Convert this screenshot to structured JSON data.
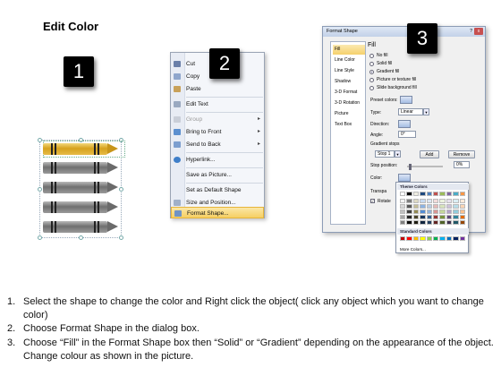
{
  "title": "Edit Color",
  "steps": {
    "one": "1",
    "two": "2",
    "three": "3"
  },
  "context_menu": {
    "items": [
      {
        "label": "Cut",
        "icon": "scissors-icon",
        "disabled": false,
        "arrow": false
      },
      {
        "label": "Copy",
        "icon": "copy-icon",
        "disabled": false,
        "arrow": false
      },
      {
        "label": "Paste",
        "icon": "paste-icon",
        "disabled": false,
        "arrow": false
      },
      {
        "label": "Edit Text",
        "icon": "edit-text-icon",
        "disabled": false,
        "arrow": false
      },
      {
        "label": "Group",
        "icon": "group-icon",
        "disabled": true,
        "arrow": true
      },
      {
        "label": "Bring to Front",
        "icon": "bring-front-icon",
        "disabled": false,
        "arrow": true
      },
      {
        "label": "Send to Back",
        "icon": "send-back-icon",
        "disabled": false,
        "arrow": true
      },
      {
        "label": "Hyperlink...",
        "icon": "hyperlink-icon",
        "disabled": false,
        "arrow": false
      },
      {
        "label": "Save as Picture...",
        "icon": "",
        "disabled": false,
        "arrow": false
      },
      {
        "label": "Set as Default Shape",
        "icon": "",
        "disabled": false,
        "arrow": false
      },
      {
        "label": "Size and Position...",
        "icon": "size-icon",
        "disabled": false,
        "arrow": false
      },
      {
        "label": "Format Shape...",
        "icon": "format-shape-icon",
        "disabled": false,
        "arrow": false
      }
    ]
  },
  "dialog": {
    "title": "Format Shape",
    "help": "?",
    "close": "x",
    "nav": [
      "Fill",
      "Line Color",
      "Line Style",
      "Shadow",
      "3-D Format",
      "3-D Rotation",
      "Picture",
      "Text Box"
    ],
    "fill_heading": "Fill",
    "fill_options": [
      "No fill",
      "Solid fill",
      "Gradient fill",
      "Picture or texture fill",
      "Slide background fill"
    ],
    "selected_fill": "Gradient fill",
    "preset_colors_label": "Preset colors:",
    "type_label": "Type:",
    "type_value": "Linear",
    "direction_label": "Direction:",
    "angle_label": "Angle:",
    "angle_value": "0°",
    "gradient_stops_label": "Gradient stops",
    "stop_value": "Stop 1",
    "add_button": "Add",
    "remove_button": "Remove",
    "stop_position_label": "Stop position:",
    "stop_position_value": "0%",
    "color_label": "Color:",
    "transparency_label": "Transpa",
    "rotate_label": "Rotate"
  },
  "palette": {
    "theme_header": "Theme Colors",
    "standard_header": "Standard Colors",
    "more_colors": "More Colors...",
    "theme_top": [
      "#ffffff",
      "#000000",
      "#eeece1",
      "#1f497d",
      "#4f81bd",
      "#c0504d",
      "#9bbb59",
      "#8064a2",
      "#4bacc6",
      "#f79646"
    ],
    "theme_columns": [
      [
        "#f2f2f2",
        "#d9d9d9",
        "#bfbfbf",
        "#a6a6a6",
        "#808080"
      ],
      [
        "#7f7f7f",
        "#595959",
        "#404040",
        "#262626",
        "#0d0d0d"
      ],
      [
        "#ddd9c3",
        "#c4bd97",
        "#948a54",
        "#4a452a",
        "#1e1c11"
      ],
      [
        "#c6d9f0",
        "#8db3e2",
        "#548dd4",
        "#17365d",
        "#0f243e"
      ],
      [
        "#dbe5f1",
        "#b8cce4",
        "#95b3d7",
        "#366092",
        "#244061"
      ],
      [
        "#f2dcdb",
        "#e5b9b7",
        "#d99694",
        "#953734",
        "#632423"
      ],
      [
        "#ebf1dd",
        "#d7e3bc",
        "#c3d69b",
        "#76923c",
        "#4f6128"
      ],
      [
        "#e5e0ec",
        "#ccc1d9",
        "#b2a2c7",
        "#5f497a",
        "#3f3151"
      ],
      [
        "#dbeef3",
        "#b7dde8",
        "#92cddc",
        "#31859b",
        "#205867"
      ],
      [
        "#fdeada",
        "#fbd5b5",
        "#fac08f",
        "#e36c09",
        "#974806"
      ]
    ],
    "standard": [
      "#c00000",
      "#ff0000",
      "#ffc000",
      "#ffff00",
      "#92d050",
      "#00b050",
      "#00b0f0",
      "#0070c0",
      "#002060",
      "#7030a0"
    ]
  },
  "instructions": [
    {
      "num": "1.",
      "text": "Select the shape to change the color and Right click the object( click any object which you want to change color)"
    },
    {
      "num": "2.",
      "text": "Choose Format Shape in the dialog box."
    },
    {
      "num": "3.",
      "text": "Choose “Fill” in the Format Shape box then “Solid” or “Gradient” depending on the appearance of the object. Change colour as shown in the picture."
    }
  ]
}
